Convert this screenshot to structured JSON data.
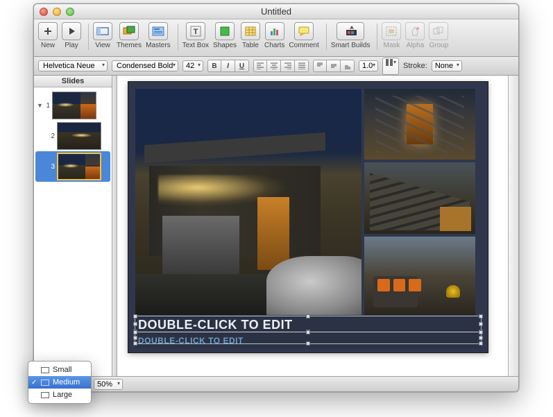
{
  "window": {
    "title": "Untitled"
  },
  "toolbar": {
    "new": "New",
    "play": "Play",
    "view": "View",
    "themes": "Themes",
    "masters": "Masters",
    "textbox": "Text Box",
    "shapes": "Shapes",
    "table": "Table",
    "charts": "Charts",
    "comment": "Comment",
    "smartbuilds": "Smart Builds",
    "mask": "Mask",
    "alpha": "Alpha",
    "group": "Group"
  },
  "format": {
    "font": "Helvetica Neue",
    "style": "Condensed Bold",
    "size": "42",
    "stroke_label": "Stroke:",
    "stroke_width": "1.0",
    "stroke_style": "None"
  },
  "sidebar": {
    "title": "Slides",
    "items": [
      {
        "num": "1"
      },
      {
        "num": "2"
      },
      {
        "num": "3"
      }
    ]
  },
  "canvas": {
    "title_placeholder": "DOUBLE-CLICK TO EDIT",
    "subtitle_placeholder": "DOUBLE-CLICK TO EDIT"
  },
  "bottom": {
    "zoom": "50%"
  },
  "popup": {
    "small": "Small",
    "medium": "Medium",
    "large": "Large"
  }
}
